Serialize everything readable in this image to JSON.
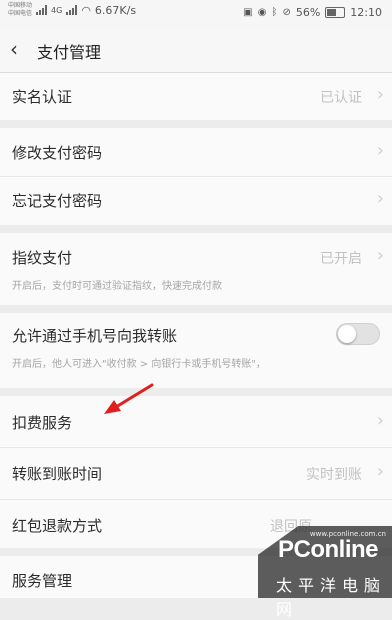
{
  "status_bar": {
    "carrier_1": "中国移动",
    "carrier_2": "中国电信",
    "network": "4G",
    "speed": "6.67K/s",
    "battery": "56%",
    "time": "12:10"
  },
  "header": {
    "title": "支付管理"
  },
  "rows": {
    "real_name": {
      "label": "实名认证",
      "value": "已认证"
    },
    "change_pwd": {
      "label": "修改支付密码"
    },
    "forgot_pwd": {
      "label": "忘记支付密码"
    },
    "fingerprint": {
      "label": "指纹支付",
      "value": "已开启",
      "desc": "开启后，支付时可通过验证指纹，快速完成付款"
    },
    "phone_transfer": {
      "label": "允许通过手机号向我转账",
      "desc": "开启后，他人可进入\"收付款 > 向银行卡或手机号转账\"，",
      "toggle_on": false
    },
    "deduction": {
      "label": "扣费服务"
    },
    "transfer_time": {
      "label": "转账到账时间",
      "value": "实时到账"
    },
    "red_packet": {
      "label": "红包退款方式",
      "value": "退回原"
    },
    "service_mgmt": {
      "label": "服务管理"
    }
  },
  "watermark": {
    "brand": "PConline",
    "domain": "www.pconline.com.cn",
    "cn": "太平洋电脑网"
  },
  "colors": {
    "annotation_arrow": "#e02020",
    "toggle_off": "#e2e2e2"
  }
}
